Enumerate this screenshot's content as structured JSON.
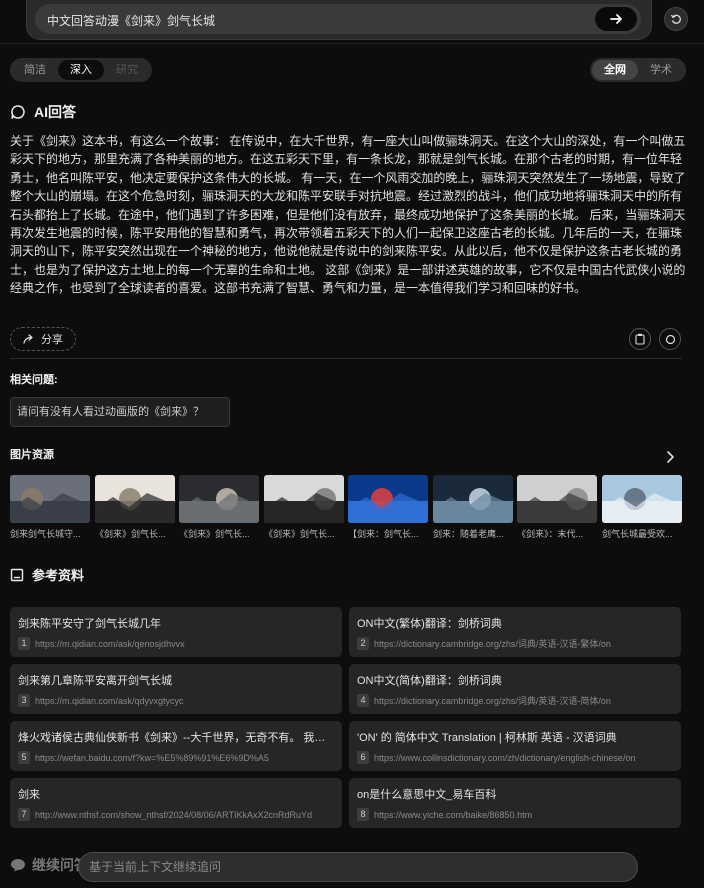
{
  "search": {
    "query": "中文回答动漫《剑来》剑气长城"
  },
  "modes": [
    "简洁",
    "深入",
    "研究"
  ],
  "scopes": [
    "全网",
    "学术"
  ],
  "ai_answer": {
    "title": "AI回答",
    "text": "关于《剑来》这本书，有这么一个故事： 在传说中，在大千世界，有一座大山叫做骊珠洞天。在这个大山的深处，有一个叫做五彩天下的地方，那里充满了各种美丽的地方。在这五彩天下里，有一条长龙，那就是剑气长城。在那个古老的时期，有一位年轻勇士，他名叫陈平安，他决定要保护这条伟大的长城。 有一天，在一个风雨交加的晚上，骊珠洞天突然发生了一场地震，导致了整个大山的崩塌。在这个危急时刻，骊珠洞天的大龙和陈平安联手对抗地震。经过激烈的战斗，他们成功地将骊珠洞天中的所有石头都抬上了长城。在途中，他们遇到了许多困难，但是他们没有放弃，最终成功地保护了这条美丽的长城。 后来，当骊珠洞天再次发生地震的时候，陈平安用他的智慧和勇气，再次带领着五彩天下的人们一起保卫这座古老的长城。几年后的一天，在骊珠洞天的山下，陈平安突然出现在一个神秘的地方，他说他就是传说中的剑来陈平安。从此以后，他不仅是保护这条古老长城的勇士，也是为了保护这方土地上的每一个无辜的生命和土地。 这部《剑来》是一部讲述英雄的故事，它不仅是中国古代武侠小说的经典之作，也受到了全球读者的喜爱。这部书充满了智慧、勇气和力量，是一本值得我们学习和回味的好书。",
    "share_label": "分享"
  },
  "related": {
    "title": "相关问题:",
    "items": [
      "请问有没有人看过动画版的《剑来》？"
    ]
  },
  "images": {
    "title": "图片资源",
    "items": [
      {
        "caption": "剑来剑气长城守...",
        "palette": [
          "#6b6f7a",
          "#3a3e48",
          "#8a7b6a"
        ]
      },
      {
        "caption": "《剑来》剑气长...",
        "palette": [
          "#e8e4dc",
          "#2a2a2a",
          "#8a8070"
        ]
      },
      {
        "caption": "《剑来》剑气长...",
        "palette": [
          "#2a2c30",
          "#6a6e74",
          "#c8c0b0"
        ]
      },
      {
        "caption": "《剑来》剑气长...",
        "palette": [
          "#d9d9d9",
          "#262626",
          "#7a7a7a"
        ]
      },
      {
        "caption": "【剑来：剑气长...",
        "palette": [
          "#0b3a8a",
          "#2f6fd6",
          "#e24040"
        ]
      },
      {
        "caption": "剑来：随着老鹰...",
        "palette": [
          "#1a2a3a",
          "#6a86a0",
          "#c8d8e8"
        ]
      },
      {
        "caption": "《剑来》：末代...",
        "palette": [
          "#cfcfcf",
          "#3a3a3a",
          "#8a8a8a"
        ]
      },
      {
        "caption": "剑气长城最受欢...",
        "palette": [
          "#a8c8e0",
          "#e6eef4",
          "#5a6a7a"
        ]
      }
    ]
  },
  "references": {
    "title": "参考资料",
    "items": [
      {
        "num": "1",
        "title": "剑来陈平安守了剑气长城几年",
        "url": "https://m.qidian.com/ask/qenosjdhvvx"
      },
      {
        "num": "2",
        "title": "ON中文(繁体)翻译：剑桥词典",
        "url": "https://dictionary.cambridge.org/zhs/词典/英语-汉语-繁体/on"
      },
      {
        "num": "3",
        "title": "剑来第几章陈平安离开剑气长城",
        "url": "https://m.qidian.com/ask/qdyvxgtycyc"
      },
      {
        "num": "4",
        "title": "ON中文(简体)翻译：剑桥词典",
        "url": "https://dictionary.cambridge.org/zhs/词典/英语-汉语-简体/on"
      },
      {
        "num": "5",
        "title": "烽火戏诸侯古典仙侠新书《剑来》--大千世界，无奇不有。 我陈平安，唯有一剑",
        "url": "https://wefan.baidu.com/f?kw=%E5%89%91%E6%9D%A5"
      },
      {
        "num": "6",
        "title": "'ON' 的 简体中文 Translation | 柯林斯 英语 - 汉语词典",
        "url": "https://www.collinsdictionary.com/zh/dictionary/english-chinese/on"
      },
      {
        "num": "7",
        "title": "剑来",
        "url": "http://www.nthsf.com/show_nthsf/2024/08/06/ARTIKkAxX2cnRdRuYd"
      },
      {
        "num": "8",
        "title": "on是什么意思中文_易车百科",
        "url": "https://www.yiche.com/baike/86850.htm"
      }
    ]
  },
  "followup": {
    "label": "继续问答",
    "placeholder": "基于当前上下文继续追问"
  }
}
